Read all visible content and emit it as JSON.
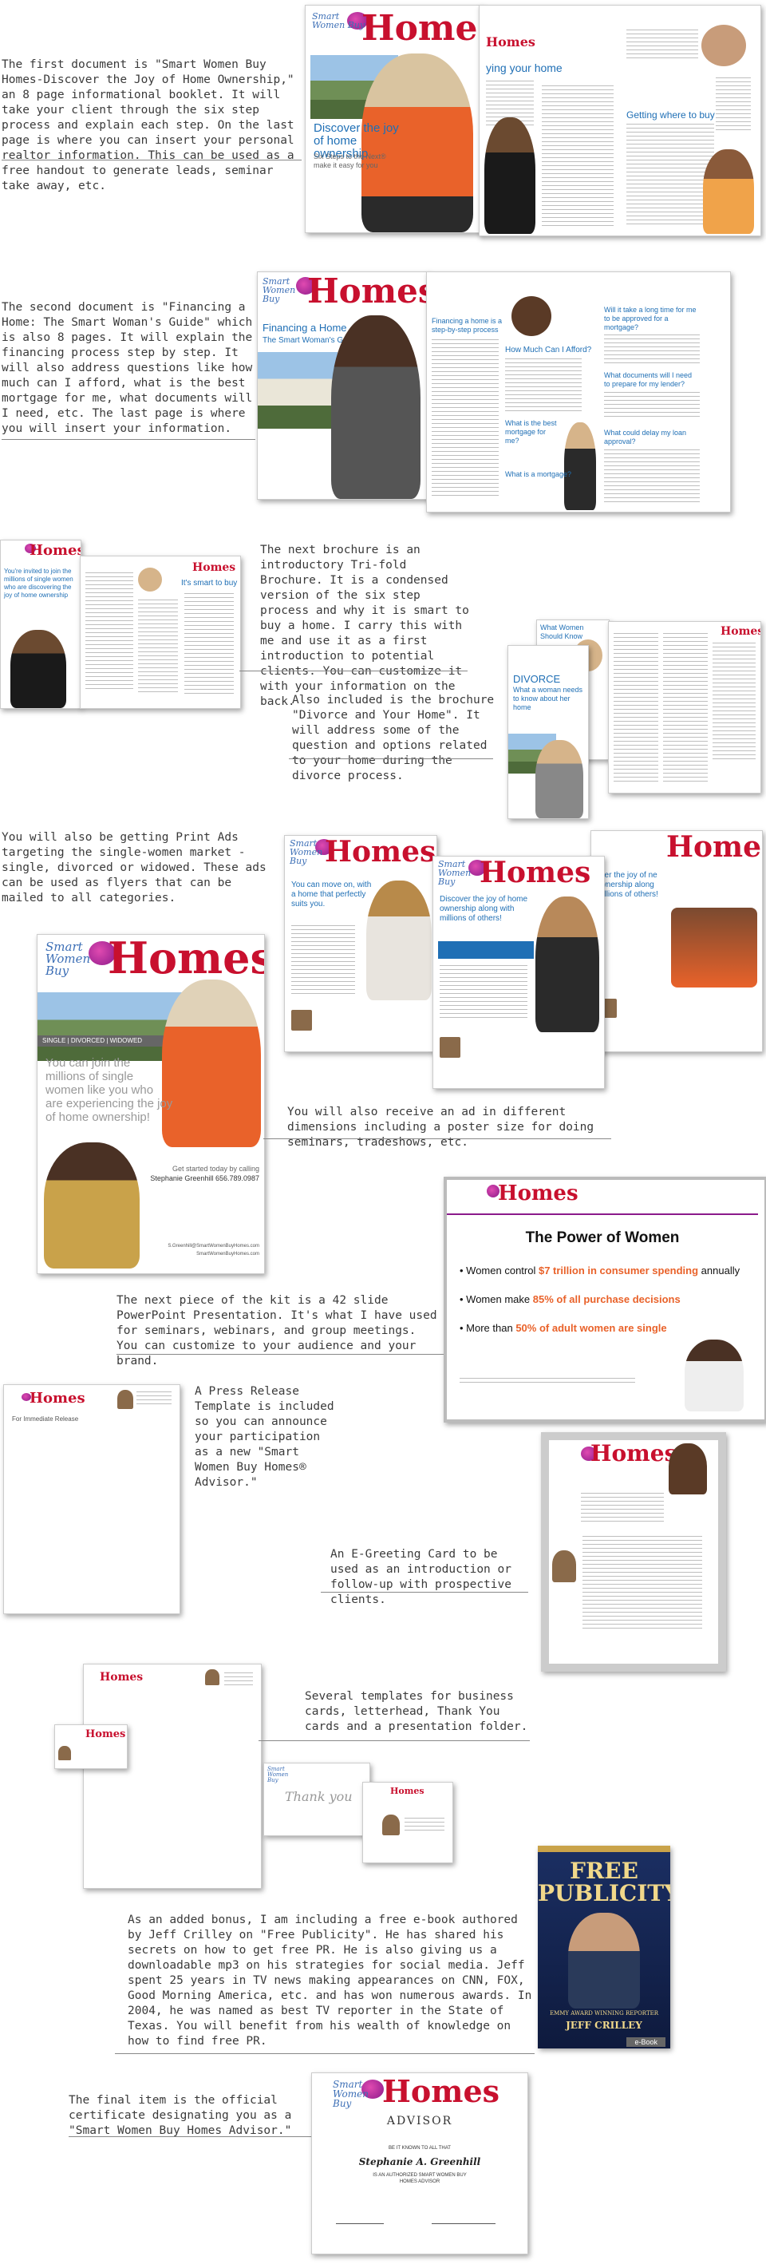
{
  "brand": {
    "smart_line": "Smart Women Buy",
    "homes": "Homes"
  },
  "sections": {
    "s1": "The first document is \"Smart Women Buy Homes-Discover the Joy of Home Ownership,\" an 8 page informational booklet.  It will take your client through the six step process and explain each step. On the last page is where you can insert your personal realtor information. This can be used as a free handout to generate leads, seminar take away, etc.",
    "s2": "The second document is \"Financing a Home: The Smart Woman's Guide\" which is also 8 pages. It will explain the financing process step by step. It will also address questions like how much can I afford, what is the best mortgage for me, what documents will I need, etc. The last page is where you will insert your information.",
    "s3": "The next brochure is an introductory Tri-fold Brochure. It is a condensed version of the six step process and why it is smart to buy a home. I carry this with me and use it as a first introduction to potential clients. You can customize it with your information on the back.",
    "s4": "Also included is the brochure \"Divorce and Your Home\". It will address some of the question and options related to your home during the divorce process.",
    "s5": "You will also be getting Print Ads targeting the single-women market - single, divorced or widowed.  These ads can be used as flyers that can be mailed to all categories.",
    "s6": "You will also receive an ad in different dimensions including a poster size for doing seminars, tradeshows, etc.",
    "s7": "The next piece of the kit is a 42 slide PowerPoint Presentation. It's what I have used for seminars, webinars, and group meetings. You can customize to your audience and your brand.",
    "s8": "A Press Release Template is included so you can announce your participation as a new \"Smart Women Buy Homes® Advisor.\"",
    "s9": "An E-Greeting Card to be used as an introduction or follow-up with prospective clients.",
    "s10": "Several templates for business cards, letterhead, Thank You cards and a presentation folder.",
    "s11": "As an added bonus, I am including a free e-book authored by Jeff Crilley on \"Free Publicity\".  He has shared his secrets on how to get free PR. He is also giving us a downloadable mp3 on his strategies for social media. Jeff spent 25 years in TV news making appearances on CNN, FOX, Good Morning America, etc. and has won numerous awards.  In 2004, he was named as best TV reporter in the State of Texas. You will benefit from his wealth of knowledge on how to find free PR.",
    "s12": "The final item is the official certificate designating you as a \"Smart Women Buy Homes Advisor.\""
  },
  "booklet1": {
    "cover_tagline": "Discover the joy of home ownership",
    "cover_sub": "Six Steps to the Next® make it easy for you",
    "inner_heading_a": "ying your home",
    "inner_heading_b": "Getting where to buy"
  },
  "booklet2": {
    "cover_title": "Financing a Home",
    "cover_sub": "The Smart Woman's Guide",
    "inner_heading_a": "Financing a home is a step-by-step process",
    "inner_heading_b": "How Much Can I Afford?",
    "inner_heading_c": "What is the best mortgage for me?",
    "inner_heading_d": "Will it take a long time for me to be approved for a mortgage?",
    "inner_heading_e": "What documents will I need to prepare for my lender?",
    "inner_heading_f": "What is a mortgage?",
    "inner_heading_g": "What could delay my loan approval?"
  },
  "trifold": {
    "invite": "You're invited to join the millions of single women who are discovering the joy of home ownership",
    "heading": "It's smart to buy"
  },
  "divorce": {
    "title": "DIVORCE",
    "sub": "What a woman needs to know about her home",
    "side": "What Women Should Know"
  },
  "ads": {
    "ad1": "You can move on, with a home that perfectly suits you.",
    "ad2": "Discover the joy of home ownership along with millions of others!",
    "ad3": "over the joy of ne ownership along millions of others!",
    "poster_banner": "SINGLE | DIVORCED | WIDOWED",
    "poster_body": "You can join the millions of single women like you who are experiencing the joy of home ownership!",
    "poster_cta": "Get started today by calling",
    "poster_name": "Stephanie Greenhill 656.789.0987",
    "poster_email": "S.Greenhill@SmartWomenBuyHomes.com",
    "poster_web": "SmartWomenBuyHomes.com"
  },
  "slide": {
    "title": "The Power of Women",
    "bullet1_pre": "Women control ",
    "bullet1_hl": "$7 trillion in consumer spending",
    "bullet1_post": " annually",
    "bullet2_pre": "Women make ",
    "bullet2_hl": "85% of all purchase decisions",
    "bullet3_pre": "More than ",
    "bullet3_hl": "50% of adult women are single"
  },
  "press": {
    "label": "For Immediate Release"
  },
  "ebook": {
    "title": "FREE PUBLICITY",
    "sub": "EMMY AWARD WINNING REPORTER",
    "author": "JEFF CRILLEY",
    "badge": "e-Book"
  },
  "greeting": {
    "thank_you": "Thank you"
  },
  "certificate": {
    "advisor": "ADVISOR",
    "be_it_known": "BE IT KNOWN TO ALL THAT",
    "name": "Stephanie A. Greenhill",
    "designation": "IS AN AUTHORIZED SMART WOMEN BUY HOMES ADVISOR"
  },
  "colors": {
    "brand_red": "#c8102e",
    "brand_blue": "#1f6fb5",
    "accent_orange": "#e9622a"
  }
}
